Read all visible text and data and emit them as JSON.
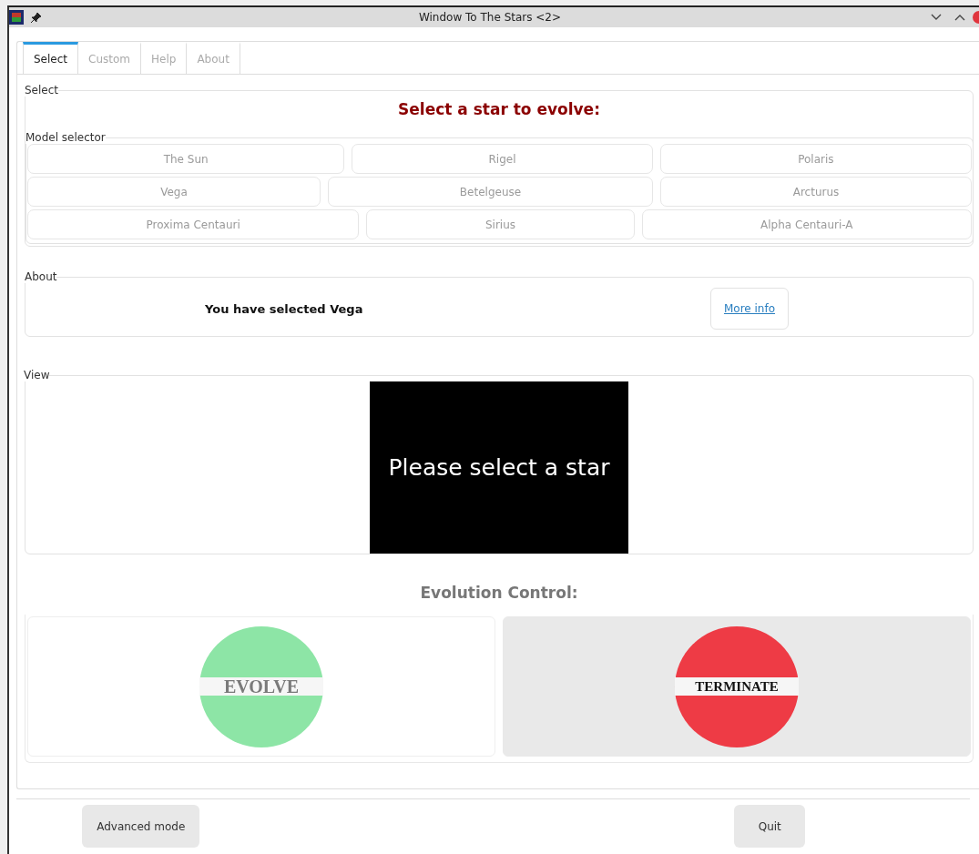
{
  "window": {
    "title": "Window To The Stars <2>"
  },
  "tabs": [
    {
      "label": "Select",
      "selected": true
    },
    {
      "label": "Custom",
      "selected": false
    },
    {
      "label": "Help",
      "selected": false
    },
    {
      "label": "About",
      "selected": false
    }
  ],
  "select_group": {
    "label": "Select",
    "heading": "Select a star to evolve:"
  },
  "model_selector": {
    "label": "Model selector",
    "rows": [
      [
        "The Sun",
        "Rigel",
        "Polaris"
      ],
      [
        "Vega",
        "Betelgeuse",
        "Arcturus"
      ],
      [
        "Proxima Centauri",
        "Sirius",
        "Alpha Centauri-A"
      ]
    ]
  },
  "about_group": {
    "label": "About",
    "message": "You have selected Vega",
    "link": "More info"
  },
  "view_group": {
    "label": "View",
    "screen_text": "Please select a star"
  },
  "evolution": {
    "title": "Evolution Control:",
    "controls": [
      {
        "label": "EVOLVE",
        "kind": "go",
        "highlighted": false
      },
      {
        "label": "TERMINATE",
        "kind": "stop",
        "highlighted": true
      }
    ]
  },
  "buttons": [
    "Advanced mode",
    "Quit"
  ]
}
